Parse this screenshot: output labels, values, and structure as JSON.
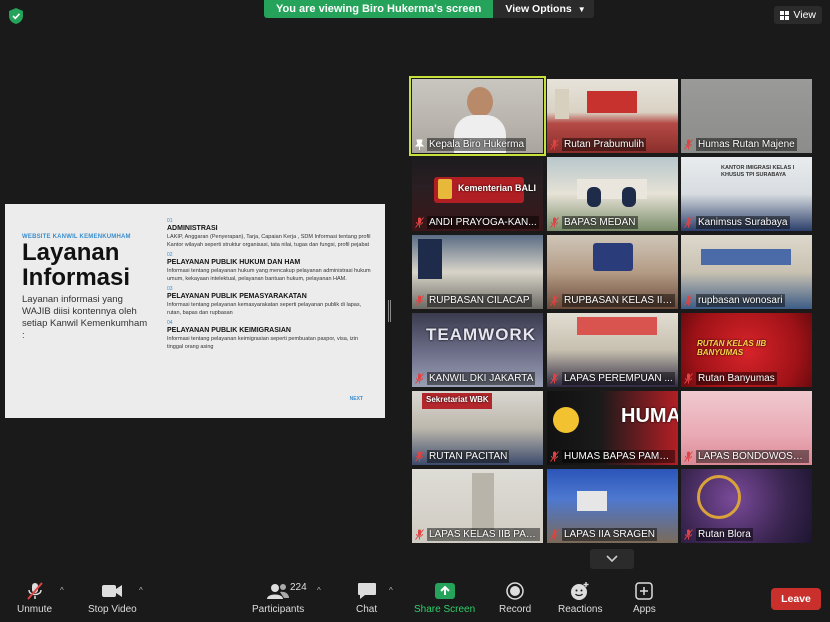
{
  "banner": {
    "viewing_text": "You are viewing Biro Hukerma's screen",
    "view_options": "View Options"
  },
  "view_button": "View",
  "colors": {
    "accent_green": "#25a35a",
    "leave_red": "#c9302c",
    "active_speaker": "#c8e03a"
  },
  "slide": {
    "eyebrow": "WEBSITE KANWIL KEMENKUMHAM",
    "title": "Layanan Informasi",
    "description": "Layanan informasi yang WAJIB diisi kontennya oleh setiap Kanwil Kemenkumham :",
    "items": [
      {
        "num": "01",
        "head": "ADMINISTRASI",
        "body": "LAKIP, Anggaran (Penyerapan), Tarja, Capaian Kerja , SDM Informasi tentang profil Kantor wilayah seperti struktur organisasi, tata nilai, tugas dan fungsi, profil pejabat"
      },
      {
        "num": "02",
        "head": "PELAYANAN PUBLIK HUKUM DAN HAM",
        "body": "Informasi tentang pelayanan hukum yang mencakup pelayanan administrasi hukum umum, kekayaan intelektual, pelayanan bantuan hukum, pelayanan HAM."
      },
      {
        "num": "03",
        "head": "PELAYANAN PUBLIK PEMASYARAKATAN",
        "body": "Informasi tentang pelayanan kemasyarakatan seperti pelayanan publik di lapas, rutan, bapas dan rupbasan"
      },
      {
        "num": "04",
        "head": "PELAYANAN PUBLIK KEIMIGRASIAN",
        "body": "Informasi tentang pelayanan keimigrasian seperti pembuatan paspor, visa, izin tinggal orang asing"
      }
    ],
    "next": "NEXT"
  },
  "gallery": [
    {
      "name": "Kepala Biro Hukerma",
      "muted": false,
      "active": true
    },
    {
      "name": "Rutan Prabumulih",
      "muted": true
    },
    {
      "name": "Humas Rutan Majene",
      "muted": true
    },
    {
      "name": "ANDI PRAYOGA-KAN...",
      "muted": true
    },
    {
      "name": "BAPAS MEDAN",
      "muted": true
    },
    {
      "name": "Kanimsus Surabaya",
      "muted": true
    },
    {
      "name": "RUPBASAN CILACAP",
      "muted": true
    },
    {
      "name": "RUPBASAN KELAS II B...",
      "muted": true
    },
    {
      "name": "rupbasan wonosari",
      "muted": true
    },
    {
      "name": "KANWIL DKI JAKARTA",
      "muted": true
    },
    {
      "name": "LAPAS PEREMPUAN ...",
      "muted": true
    },
    {
      "name": "Rutan Banyumas",
      "muted": true
    },
    {
      "name": "RUTAN PACITAN",
      "muted": true
    },
    {
      "name": "HUMAS BAPAS PAME...",
      "muted": true
    },
    {
      "name": "LAPAS BONDOWOSO...",
      "muted": true
    },
    {
      "name": "LAPAS KELAS IIB PAN...",
      "muted": true
    },
    {
      "name": "LAPAS IIA SRAGEN",
      "muted": true
    },
    {
      "name": "Rutan Blora",
      "muted": true
    }
  ],
  "tile_text": {
    "bali": "Kementerian BALI",
    "kanimsus": "KANTOR IMIGRASI KELAS I KHUSUS TPI SURABAYA",
    "teamwork": "TEAMWORK",
    "banyumas": "RUTAN KELAS IIB BANYUMAS",
    "sekretariat": "Sekretariat WBK",
    "humas": "HUMA"
  },
  "toolbar": {
    "unmute": "Unmute",
    "stop_video": "Stop Video",
    "participants": "Participants",
    "participants_count": "224",
    "chat": "Chat",
    "share_screen": "Share Screen",
    "record": "Record",
    "reactions": "Reactions",
    "apps": "Apps",
    "leave": "Leave"
  }
}
